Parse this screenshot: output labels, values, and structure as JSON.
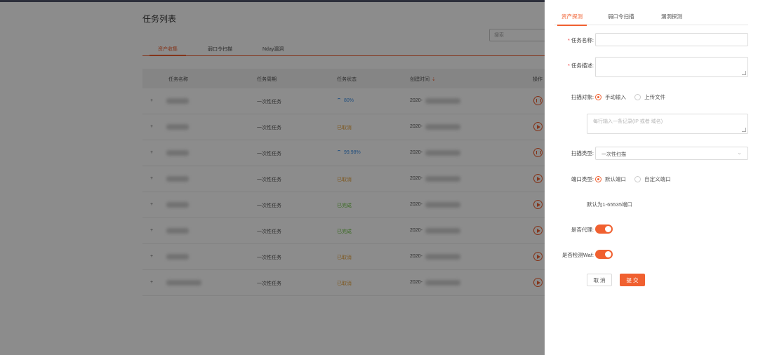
{
  "page": {
    "title": "任务列表",
    "search_placeholder": "搜索",
    "tabs": [
      "资产收集",
      "弱口令扫描",
      "Nday漏洞"
    ],
    "table": {
      "headers": [
        "任务名称",
        "任务周期",
        "任务状态",
        "创建时间",
        "操作"
      ],
      "rows": [
        {
          "expand": "+",
          "cycle": "一次性任务",
          "status": "80%",
          "status_type": "running",
          "created": "2020-"
        },
        {
          "expand": "+",
          "cycle": "一次性任务",
          "status": "已取消",
          "status_type": "cancelled",
          "created": "2020-"
        },
        {
          "expand": "+",
          "cycle": "一次性任务",
          "status": "99.98%",
          "status_type": "running",
          "created": "2020-"
        },
        {
          "expand": "+",
          "cycle": "一次性任务",
          "status": "已取消",
          "status_type": "cancelled",
          "created": "2020-"
        },
        {
          "expand": "+",
          "cycle": "一次性任务",
          "status": "已完成",
          "status_type": "done",
          "created": "2020-"
        },
        {
          "expand": "+",
          "cycle": "一次性任务",
          "status": "已完成",
          "status_type": "done",
          "created": "2020-"
        },
        {
          "expand": "+",
          "cycle": "一次性任务",
          "status": "已取消",
          "status_type": "cancelled",
          "created": "2020-"
        },
        {
          "expand": "+",
          "cycle": "一次性任务",
          "status": "已取消",
          "status_type": "cancelled",
          "created": "2020-"
        }
      ]
    }
  },
  "drawer": {
    "tabs": [
      "资产探测",
      "弱口令扫描",
      "漏洞探测"
    ],
    "form": {
      "task_name_label": "任务名称:",
      "task_desc_label": "任务描述:",
      "scan_target_label": "扫描对象:",
      "scan_target_options": [
        "手动输入",
        "上传文件"
      ],
      "targets_placeholder": "每行输入一条记录(IP 或者 域名)",
      "scan_type_label": "扫描类型:",
      "scan_type_value": "一次性扫描",
      "port_type_label": "端口类型:",
      "port_type_options": [
        "默认端口",
        "自定义端口"
      ],
      "port_hint": "默认为1-65535端口",
      "proxy_label": "是否代理:",
      "proxy_on": true,
      "waf_label": "是否检测Waf:",
      "waf_on": true,
      "cancel_label": "取 消",
      "submit_label": "提 交"
    }
  },
  "colors": {
    "accent": "#f06030",
    "running": "#3a8ee6",
    "cancelled": "#e6a23c",
    "done": "#67c23a"
  }
}
